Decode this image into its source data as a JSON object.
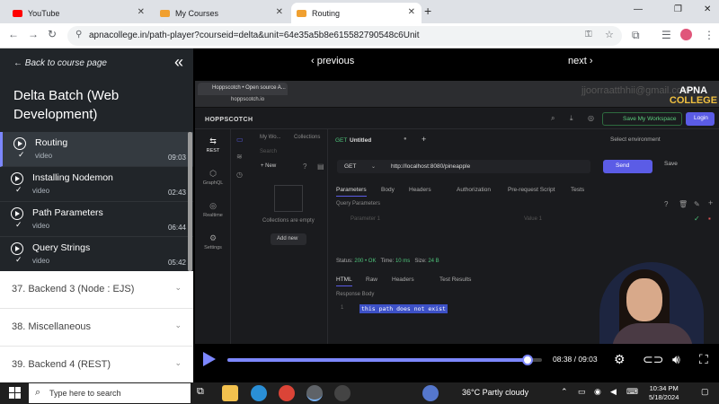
{
  "browser": {
    "tabs": [
      {
        "label": "YouTube",
        "color": "#ff0000"
      },
      {
        "label": "My Courses",
        "color": "#f0a030"
      },
      {
        "label": "Routing",
        "color": "#f0a030",
        "active": true
      }
    ],
    "url": "apnacollege.in/path-player?courseid=delta&unit=64e35a5b8e615582790548c6Unit"
  },
  "sidebar": {
    "back_label": "← Back to course page",
    "course_title": "Delta Batch (Web Development)",
    "lessons": [
      {
        "title": "Routing",
        "sub": "video",
        "duration": "09:03",
        "active": true
      },
      {
        "title": "Installing Nodemon",
        "sub": "video",
        "duration": "02:43"
      },
      {
        "title": "Path Parameters",
        "sub": "video",
        "duration": "06:44"
      },
      {
        "title": "Query Strings",
        "sub": "video",
        "duration": "05:42"
      }
    ],
    "sections": [
      {
        "title": "37. Backend 3 (Node : EJS)"
      },
      {
        "title": "38. Miscellaneous"
      },
      {
        "title": "39. Backend 4 (REST)"
      }
    ]
  },
  "player": {
    "prev_label": "‹ previous",
    "next_label": "next ›",
    "time": "08:38 / 09:03",
    "progress": 0.954,
    "accent": "#7c87ff"
  },
  "inner": {
    "tab_label": "Hoppscotch • Open source A...",
    "url": "hoppscotch.io",
    "watermark": "jjoorraatthhii@gmail.com",
    "brand_1": "APNA",
    "brand_2": "COLLEGE",
    "app_name": "HOPPSCOTCH",
    "workspace_label": "Save My Workspace",
    "login_label": "Login",
    "nav": [
      {
        "label": "REST",
        "icon": "⇆"
      },
      {
        "label": "GraphQL",
        "icon": "⬡"
      },
      {
        "label": "Realtime",
        "icon": "◎"
      },
      {
        "label": "Settings",
        "icon": "⚙"
      }
    ],
    "collections": {
      "crumb_1": "My Wo...",
      "crumb_2": "Collections",
      "search_placeholder": "Search",
      "new_label": "+ New",
      "empty_label": "Collections are empty",
      "add_label": "Add new"
    },
    "request": {
      "method_tab": "GET",
      "tab_title": "Untitled",
      "env_label": "Select environment",
      "method": "GET",
      "url": "http://localhost:8080/pineapple",
      "send_label": "Send",
      "save_label": "Save",
      "subtabs": [
        "Parameters",
        "Body",
        "Headers",
        "Authorization",
        "Pre-request Script",
        "Tests"
      ],
      "query_params_label": "Query Parameters",
      "param_placeholder": "Parameter 1",
      "value_placeholder": "Value 1"
    },
    "response": {
      "status_label": "Status:",
      "status_value": "200 • OK",
      "time_label": "Time:",
      "time_value": "10 ms",
      "size_label": "Size:",
      "size_value": "24 B",
      "tabs": [
        "HTML",
        "Raw",
        "Headers",
        "Test Results"
      ],
      "body_label": "Response Body",
      "line_no": "1",
      "body": "this path does not exist"
    }
  },
  "taskbar": {
    "search_placeholder": "Type here to search",
    "weather": "36°C  Partly cloudy",
    "time": "10:34 PM",
    "date": "5/18/2024"
  }
}
